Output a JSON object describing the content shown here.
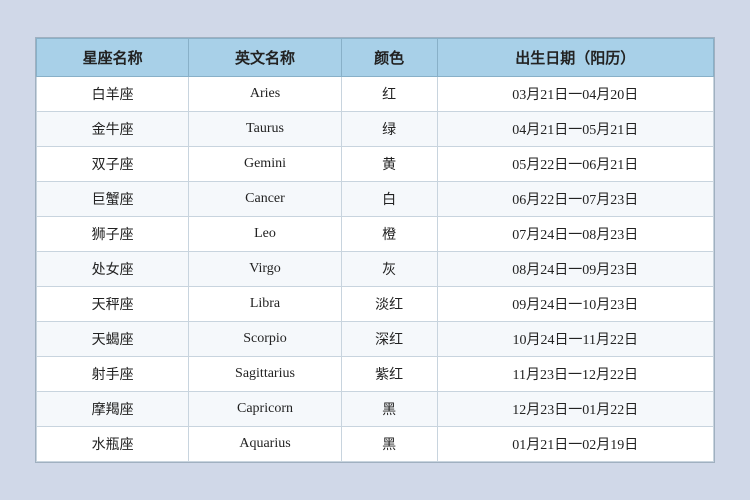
{
  "table": {
    "headers": [
      "星座名称",
      "英文名称",
      "颜色",
      "出生日期（阳历）"
    ],
    "rows": [
      [
        "白羊座",
        "Aries",
        "红",
        "03月21日一04月20日"
      ],
      [
        "金牛座",
        "Taurus",
        "绿",
        "04月21日一05月21日"
      ],
      [
        "双子座",
        "Gemini",
        "黄",
        "05月22日一06月21日"
      ],
      [
        "巨蟹座",
        "Cancer",
        "白",
        "06月22日一07月23日"
      ],
      [
        "狮子座",
        "Leo",
        "橙",
        "07月24日一08月23日"
      ],
      [
        "处女座",
        "Virgo",
        "灰",
        "08月24日一09月23日"
      ],
      [
        "天秤座",
        "Libra",
        "淡红",
        "09月24日一10月23日"
      ],
      [
        "天蝎座",
        "Scorpio",
        "深红",
        "10月24日一11月22日"
      ],
      [
        "射手座",
        "Sagittarius",
        "紫红",
        "11月23日一12月22日"
      ],
      [
        "摩羯座",
        "Capricorn",
        "黑",
        "12月23日一01月22日"
      ],
      [
        "水瓶座",
        "Aquarius",
        "黑",
        "01月21日一02月19日"
      ]
    ]
  }
}
